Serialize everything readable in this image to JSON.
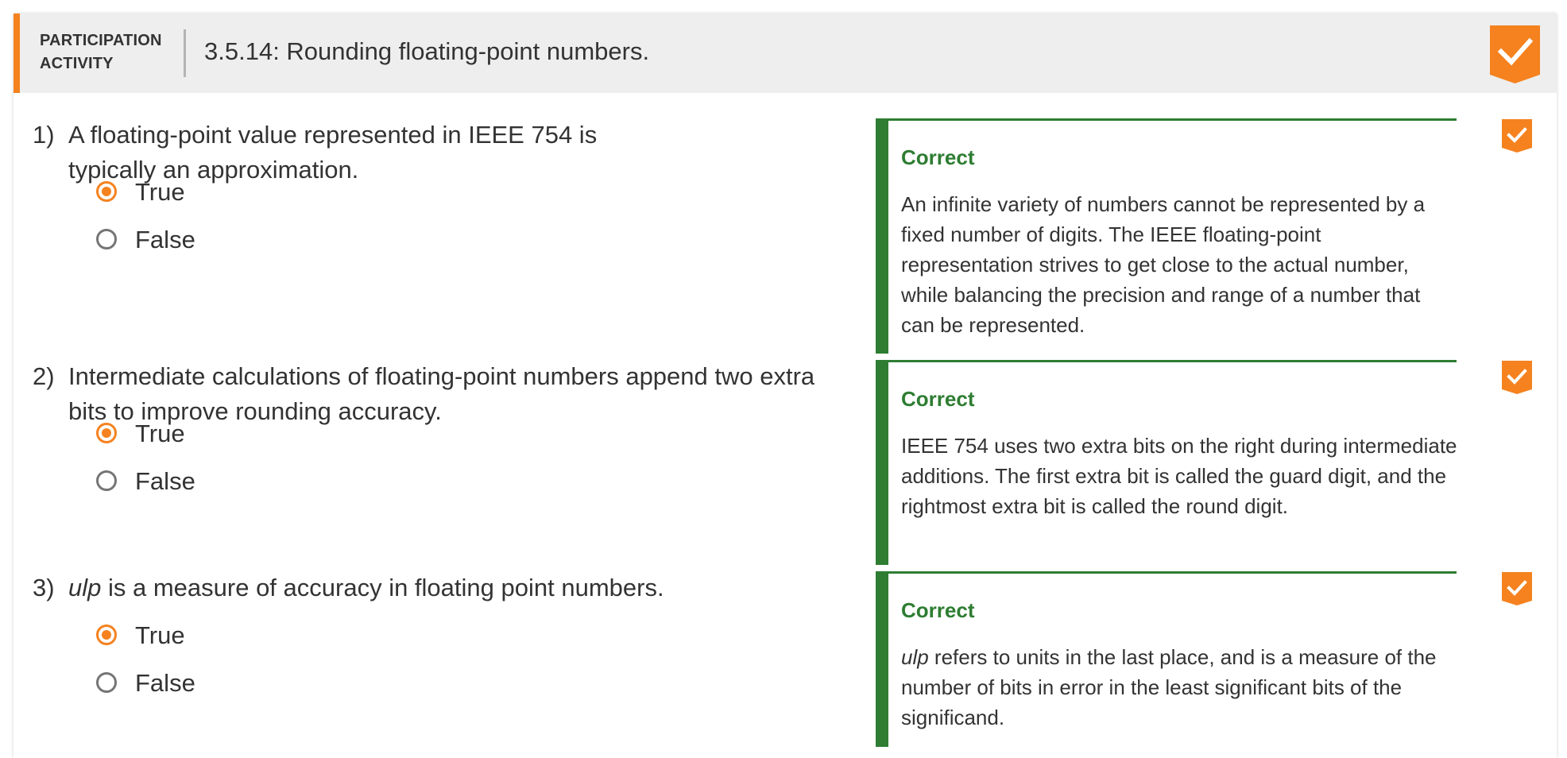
{
  "colors": {
    "accent": "#f5821f",
    "correct": "#2e7d32",
    "header_bg": "#eeeeee",
    "text": "#333333"
  },
  "header": {
    "activity_type": "PARTICIPATION ACTIVITY",
    "title": "3.5.14: Rounding floating-point numbers.",
    "completion_icon": "checkmark-icon"
  },
  "questions": [
    {
      "number": "1)",
      "text": "A floating-point value represented in IEEE 754 is typically an approximation.",
      "options": [
        {
          "label": "True",
          "selected": true
        },
        {
          "label": "False",
          "selected": false
        }
      ],
      "feedback": {
        "title": "Correct",
        "emphasis": "",
        "text": "An infinite variety of numbers cannot be represented by a fixed number of digits. The IEEE floating-point representation strives to get close to the actual number, while balancing the precision and range of a number that can be represented."
      },
      "status_icon": "checkmark-icon"
    },
    {
      "number": "2)",
      "text": "Intermediate calculations of floating-point numbers append two extra bits to improve rounding accuracy.",
      "options": [
        {
          "label": "True",
          "selected": true
        },
        {
          "label": "False",
          "selected": false
        }
      ],
      "feedback": {
        "title": "Correct",
        "emphasis": "",
        "text": "IEEE 754 uses two extra bits on the right during intermediate additions. The first extra bit is called the guard digit, and the rightmost extra bit is called the round digit."
      },
      "status_icon": "checkmark-icon"
    },
    {
      "number": "3)",
      "emphasis": "ulp",
      "text": " is a measure of accuracy in floating point numbers.",
      "options": [
        {
          "label": "True",
          "selected": true
        },
        {
          "label": "False",
          "selected": false
        }
      ],
      "feedback": {
        "title": "Correct",
        "emphasis": "ulp",
        "text": " refers to units in the last place, and is a measure of the number of bits in error in the least significant bits of the significand."
      },
      "status_icon": "checkmark-icon"
    }
  ]
}
